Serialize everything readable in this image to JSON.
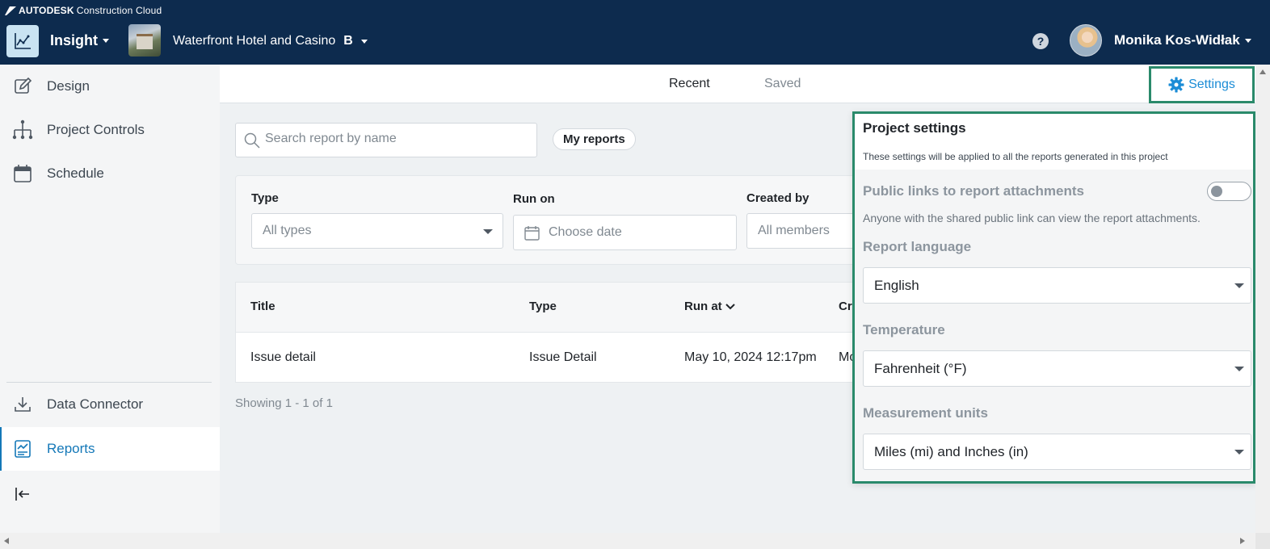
{
  "brand": {
    "company": "AUTODESK",
    "product": "Construction Cloud"
  },
  "header": {
    "app_name": "Insight",
    "project_name": "Waterfront Hotel and Casino",
    "project_badge": "B",
    "help_glyph": "?",
    "user_name": "Monika Kos-Widłak"
  },
  "sidebar": {
    "items": [
      {
        "label": "Design",
        "icon": "pencil-square-icon"
      },
      {
        "label": "Project Controls",
        "icon": "hierarchy-icon"
      },
      {
        "label": "Schedule",
        "icon": "calendar-icon"
      },
      {
        "label": "Data Connector",
        "icon": "download-icon"
      },
      {
        "label": "Reports",
        "icon": "report-chart-icon",
        "active": true
      }
    ]
  },
  "tabs": {
    "recent": "Recent",
    "saved": "Saved",
    "settings": "Settings"
  },
  "search": {
    "placeholder": "Search report by name"
  },
  "my_reports": "My reports",
  "filters": {
    "type_label": "Type",
    "type_value": "All types",
    "run_on_label": "Run on",
    "run_on_placeholder": "Choose date",
    "created_by_label": "Created by",
    "created_by_value": "All members"
  },
  "table": {
    "columns": [
      "Title",
      "Type",
      "Run at",
      "Cr"
    ],
    "rows": [
      {
        "title": "Issue detail",
        "type": "Issue Detail",
        "run_at": "May 10, 2024 12:17pm",
        "created_by": "Mo"
      }
    ]
  },
  "showing": "Showing 1 - 1 of 1",
  "settings_panel": {
    "title": "Project settings",
    "subtitle": "These settings will be applied to all the reports generated in this project",
    "public_links_label": "Public links to report attachments",
    "public_links_enabled": false,
    "public_links_desc": "Anyone with the shared public link can view the report attachments.",
    "language_label": "Report language",
    "language_value": "English",
    "temperature_label": "Temperature",
    "temperature_value": "Fahrenheit (°F)",
    "units_label": "Measurement units",
    "units_value": "Miles (mi) and Inches (in)"
  },
  "colors": {
    "header_bg": "#0d2b4e",
    "accent": "#1b8cd6",
    "highlight": "#2a8a6b"
  }
}
